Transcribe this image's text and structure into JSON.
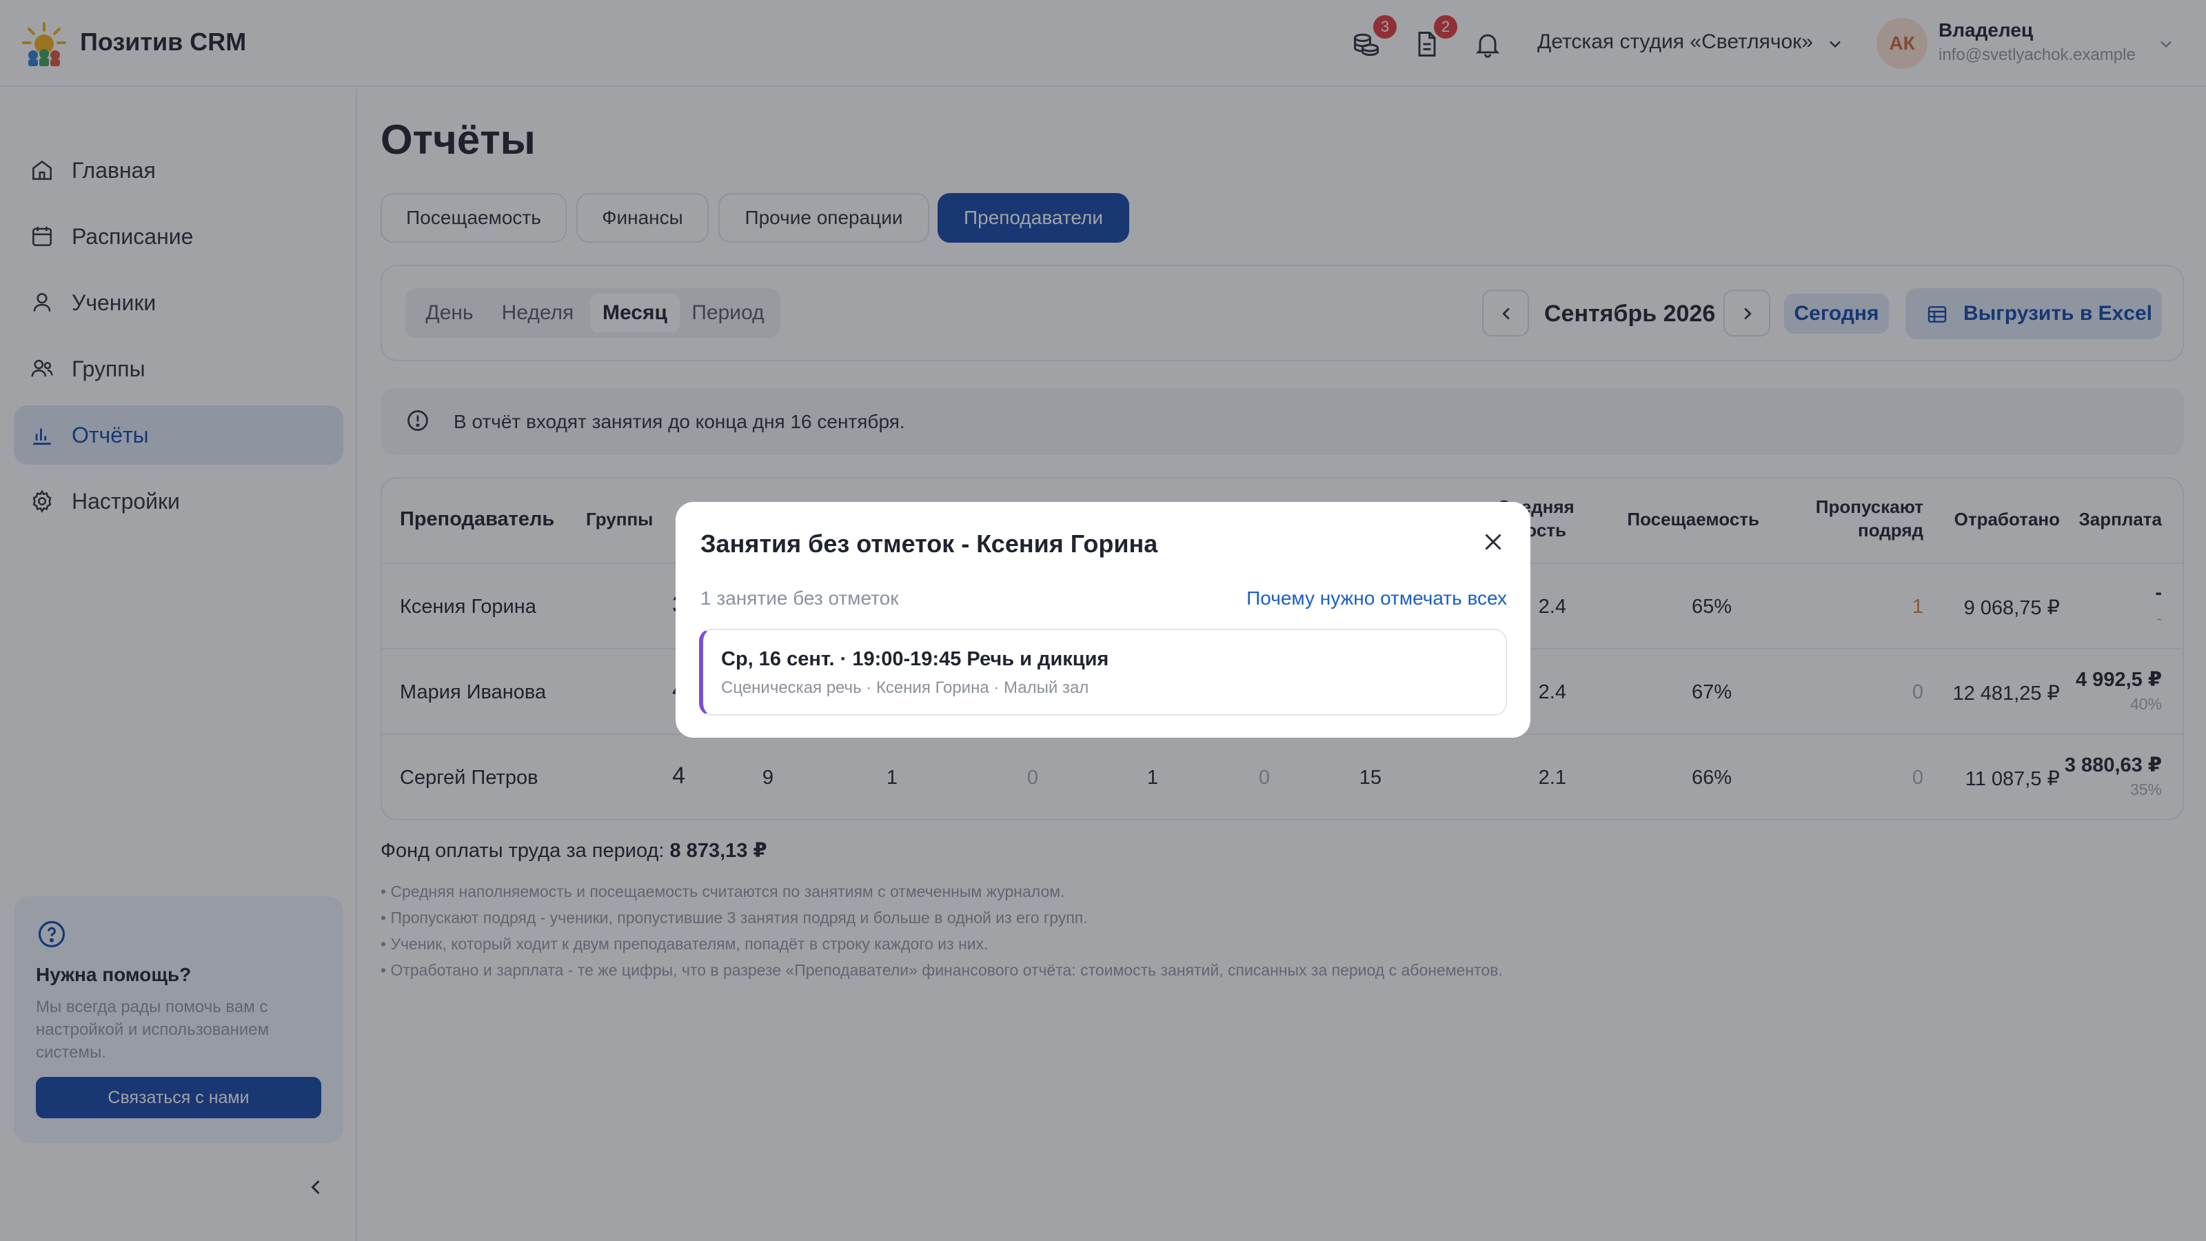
{
  "header": {
    "brand": "Позитив CRM",
    "badges": {
      "coins": "3",
      "docs": "2"
    },
    "studio": "Детская студия «Светлячок»",
    "user": {
      "initials": "АК",
      "role": "Владелец",
      "email": "info@svetlyachok.example"
    }
  },
  "sidebar": {
    "items": [
      {
        "label": "Главная",
        "icon": "home-icon"
      },
      {
        "label": "Расписание",
        "icon": "calendar-icon"
      },
      {
        "label": "Ученики",
        "icon": "user-icon"
      },
      {
        "label": "Группы",
        "icon": "users-icon"
      },
      {
        "label": "Отчёты",
        "icon": "chart-icon",
        "active": true
      },
      {
        "label": "Настройки",
        "icon": "gear-icon"
      }
    ],
    "help": {
      "title": "Нужна помощь?",
      "text": "Мы всегда рады помочь вам с настройкой и использованием системы.",
      "button": "Связаться с нами"
    }
  },
  "page": {
    "title": "Отчёты",
    "tabs": [
      {
        "label": "Посещаемость"
      },
      {
        "label": "Финансы"
      },
      {
        "label": "Прочие операции"
      },
      {
        "label": "Преподаватели",
        "active": true
      }
    ],
    "periods": [
      {
        "label": "День"
      },
      {
        "label": "Неделя"
      },
      {
        "label": "Месяц",
        "active": true
      },
      {
        "label": "Период"
      }
    ],
    "month": "Сентябрь 2026",
    "today": "Сегодня",
    "export": "Выгрузить в Excel",
    "info": "В отчёт входят занятия до конца дня 16 сентября."
  },
  "table": {
    "headers": {
      "teacher": "Преподаватель",
      "groups": "Группы",
      "avg_fill_1": "Средняя",
      "avg_fill_2": "...ость",
      "attendance": "Посещаемость",
      "skip_1": "Пропускают",
      "skip_2": "подряд",
      "worked": "Отработано",
      "salary": "Зарплата"
    },
    "rows": [
      {
        "teacher": "Ксения Горина",
        "groups": "3",
        "avg": "2.4",
        "attendance": "65%",
        "skip": "1",
        "worked": "9 068,75 ₽",
        "salary": "-",
        "salary_pct": "-"
      },
      {
        "teacher": "Мария Иванова",
        "groups": "4",
        "avg": "2.4",
        "attendance": "67%",
        "skip": "0",
        "worked": "12 481,25 ₽",
        "salary": "4 992,5 ₽",
        "salary_pct": "40%"
      },
      {
        "teacher": "Сергей Петров",
        "groups": "4",
        "c3": "9",
        "c4": "1",
        "c5": "0",
        "c6": "1",
        "c7": "0",
        "c8": "15",
        "avg": "2.1",
        "attendance": "66%",
        "skip": "0",
        "worked": "11 087,5 ₽",
        "salary": "3 880,63 ₽",
        "salary_pct": "35%"
      }
    ]
  },
  "fund": {
    "label": "Фонд оплаты труда за период:",
    "value": "8 873,13 ₽"
  },
  "notes": [
    "• Средняя наполняемость и посещаемость считаются по занятиям с отмеченным журналом.",
    "• Пропускают подряд - ученики, пропустившие 3 занятия подряд и больше в одной из его групп.",
    "• Ученик, который ходит к двум преподавателям, попадёт в строку каждого из них.",
    "• Отработано и зарплата - те же цифры, что в разрезе «Преподаватели» финансового отчёта: стоимость занятий, списанных за период с абонементов."
  ],
  "modal": {
    "title": "Занятия без отметок - Ксения Горина",
    "count": "1 занятие без отметок",
    "link": "Почему нужно отмечать всех",
    "lesson": {
      "title": "Ср, 16 сент. · 19:00-19:45 Речь и дикция",
      "subtitle": "Сценическая речь · Ксения Горина · Малый зал"
    }
  },
  "colors": {
    "primary": "#1447a8",
    "primary_light": "#dfe8f7",
    "accent_purple": "#7b4fd6",
    "badge_red": "#e23b3b",
    "warning_orange": "#d9822b"
  }
}
